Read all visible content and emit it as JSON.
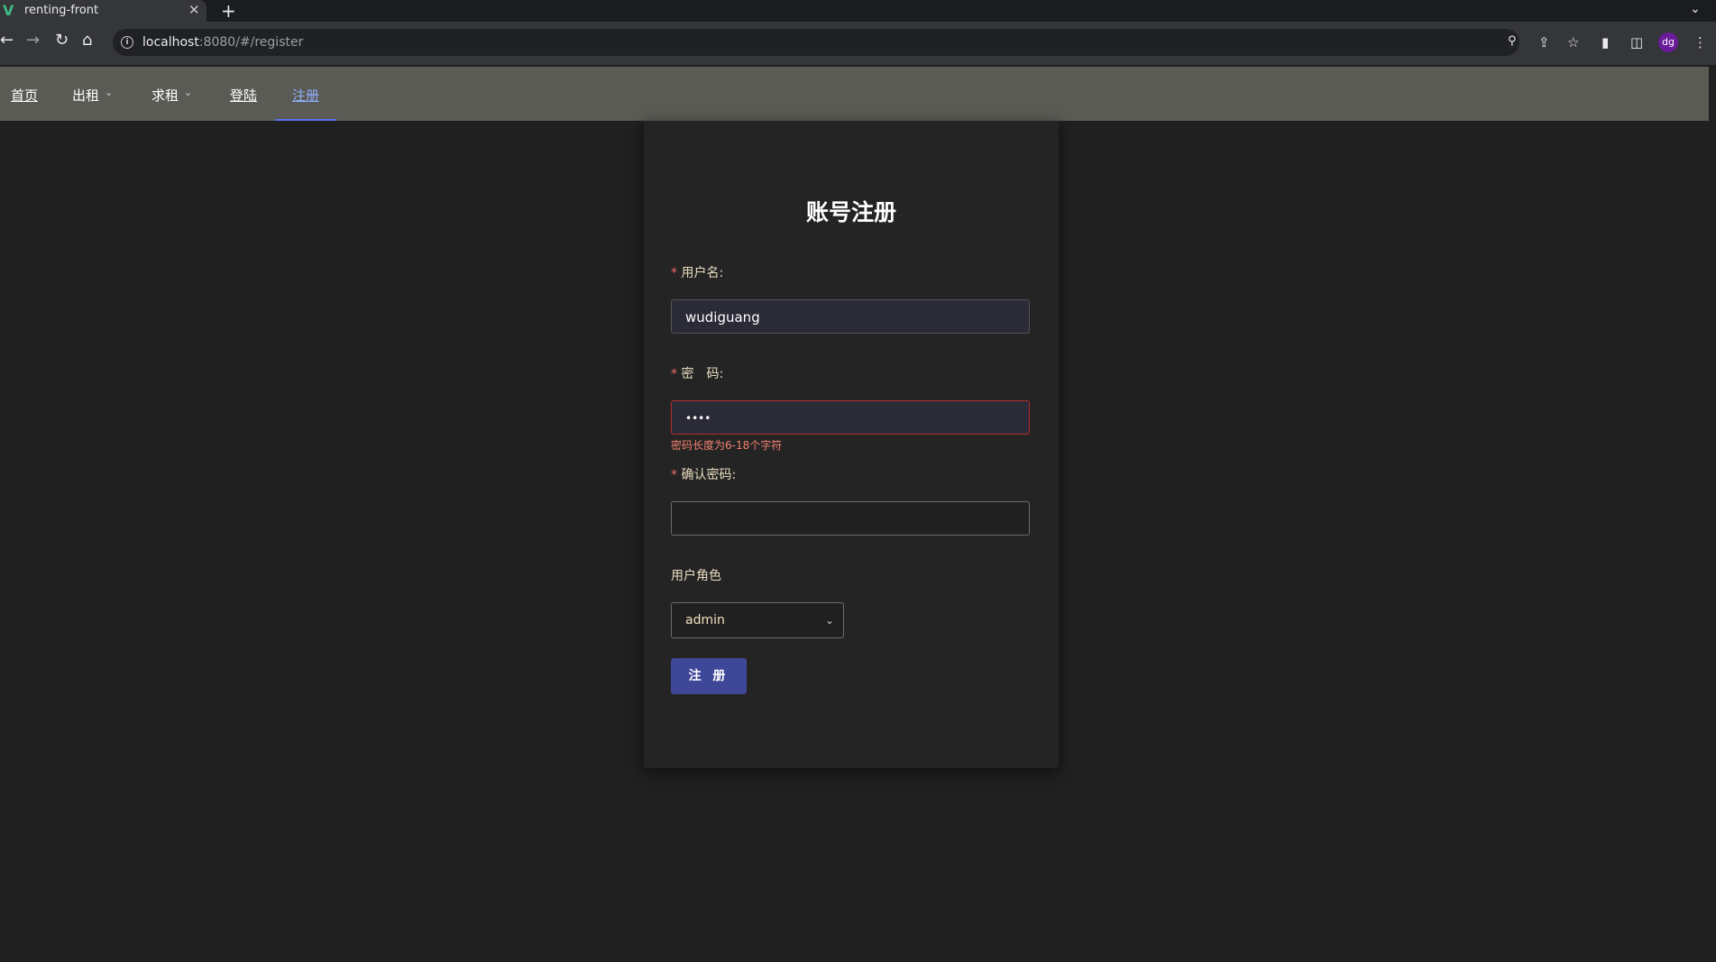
{
  "browser": {
    "tab_title": "renting-front",
    "tab_favicon": "V",
    "tab_close": "✕",
    "new_tab": "+",
    "url_host": "localhost",
    "url_rest": ":8080/#/register",
    "icons": [
      "back-icon",
      "forward-icon",
      "reload-icon",
      "home-icon",
      "info-icon",
      "key-icon",
      "share-icon",
      "star-icon",
      "extensions-icon",
      "sidepanel-icon",
      "profile-avatar",
      "menu-icon"
    ],
    "avatar_text": "dg"
  },
  "nav": {
    "home": "首页",
    "rent_out": "出租",
    "seek_rent": "求租",
    "login": "登陆",
    "register": "注册"
  },
  "form": {
    "title": "账号注册",
    "required_mark": "*",
    "username_label": "用户名:",
    "username_value": "wudiguang",
    "password_label": "密　码:",
    "password_value": "••••",
    "password_error": "密码长度为6-18个字符",
    "confirm_label": "确认密码:",
    "confirm_value": "",
    "role_label": "用户角色",
    "role_value": "admin",
    "submit_label": "注 册"
  },
  "colors": {
    "navbar_bg": "#5b5b55",
    "active_nav": "#8fb0ff",
    "button_bg": "#3f4798",
    "error": "#f3806f"
  }
}
